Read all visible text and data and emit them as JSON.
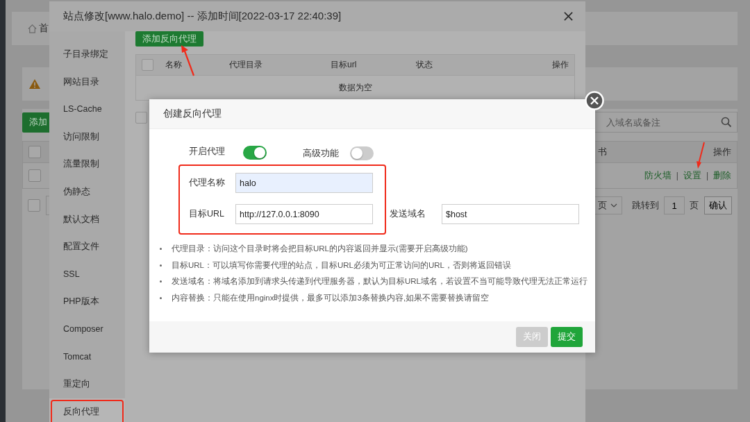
{
  "background_page": {
    "breadcrumb": "首",
    "add_button": "添加",
    "search": {
      "placeholder": "入域名或备注"
    },
    "table": {
      "header_checked": false,
      "columns": [
        "书",
        "操作"
      ],
      "action_separator": "|",
      "rows": [
        {
          "checked": false,
          "actions": [
            "防火墙",
            "设置",
            "删除"
          ]
        }
      ]
    },
    "pagination": {
      "checked": false,
      "per_page": "页",
      "goto_label": "跳转到",
      "page": "1",
      "page_unit": "页",
      "confirm": "确认"
    }
  },
  "site_dialog": {
    "title": "站点修改[www.halo.demo] -- 添加时间[2022-03-17 22:40:39]",
    "sidebar": [
      {
        "label": "子目录绑定",
        "selected": false
      },
      {
        "label": "网站目录",
        "selected": false
      },
      {
        "label": "LS-Cache",
        "selected": false
      },
      {
        "label": "访问限制",
        "selected": false
      },
      {
        "label": "流量限制",
        "selected": false
      },
      {
        "label": "伪静态",
        "selected": false
      },
      {
        "label": "默认文档",
        "selected": false
      },
      {
        "label": "配置文件",
        "selected": false
      },
      {
        "label": "SSL",
        "selected": false
      },
      {
        "label": "PHP版本",
        "selected": false
      },
      {
        "label": "Composer",
        "selected": false
      },
      {
        "label": "Tomcat",
        "selected": false
      },
      {
        "label": "重定向",
        "selected": false
      },
      {
        "label": "反向代理",
        "selected": true
      }
    ],
    "add_button": "添加反向代理",
    "table": {
      "header_checked": false,
      "columns": [
        "名称",
        "代理目录",
        "目标url",
        "状态",
        "操作"
      ],
      "empty_text": "数据为空"
    },
    "batch_checked": false
  },
  "proxy_dialog": {
    "title": "创建反向代理",
    "toggles": [
      {
        "label": "开启代理",
        "on": true
      },
      {
        "label": "高级功能",
        "on": false
      }
    ],
    "fields": [
      {
        "label": "代理名称",
        "value": "halo",
        "focused": true
      },
      {
        "label": "目标URL",
        "value": "http://127.0.0.1:8090",
        "focused": false
      }
    ],
    "host_field": {
      "label": "发送域名",
      "value": "$host"
    },
    "notes": [
      "代理目录：访问这个目录时将会把目标URL的内容返回并显示(需要开启高级功能)",
      "目标URL：可以填写你需要代理的站点，目标URL必须为可正常访问的URL，否则将返回错误",
      "发送域名：将域名添加到请求头传递到代理服务器，默认为目标URL域名，若设置不当可能导致代理无法正常运行",
      "内容替换：只能在使用nginx时提供，最多可以添加3条替换内容,如果不需要替换请留空"
    ],
    "buttons": [
      {
        "label": "关闭",
        "disabled": true
      },
      {
        "label": "提交",
        "disabled": false
      }
    ]
  }
}
